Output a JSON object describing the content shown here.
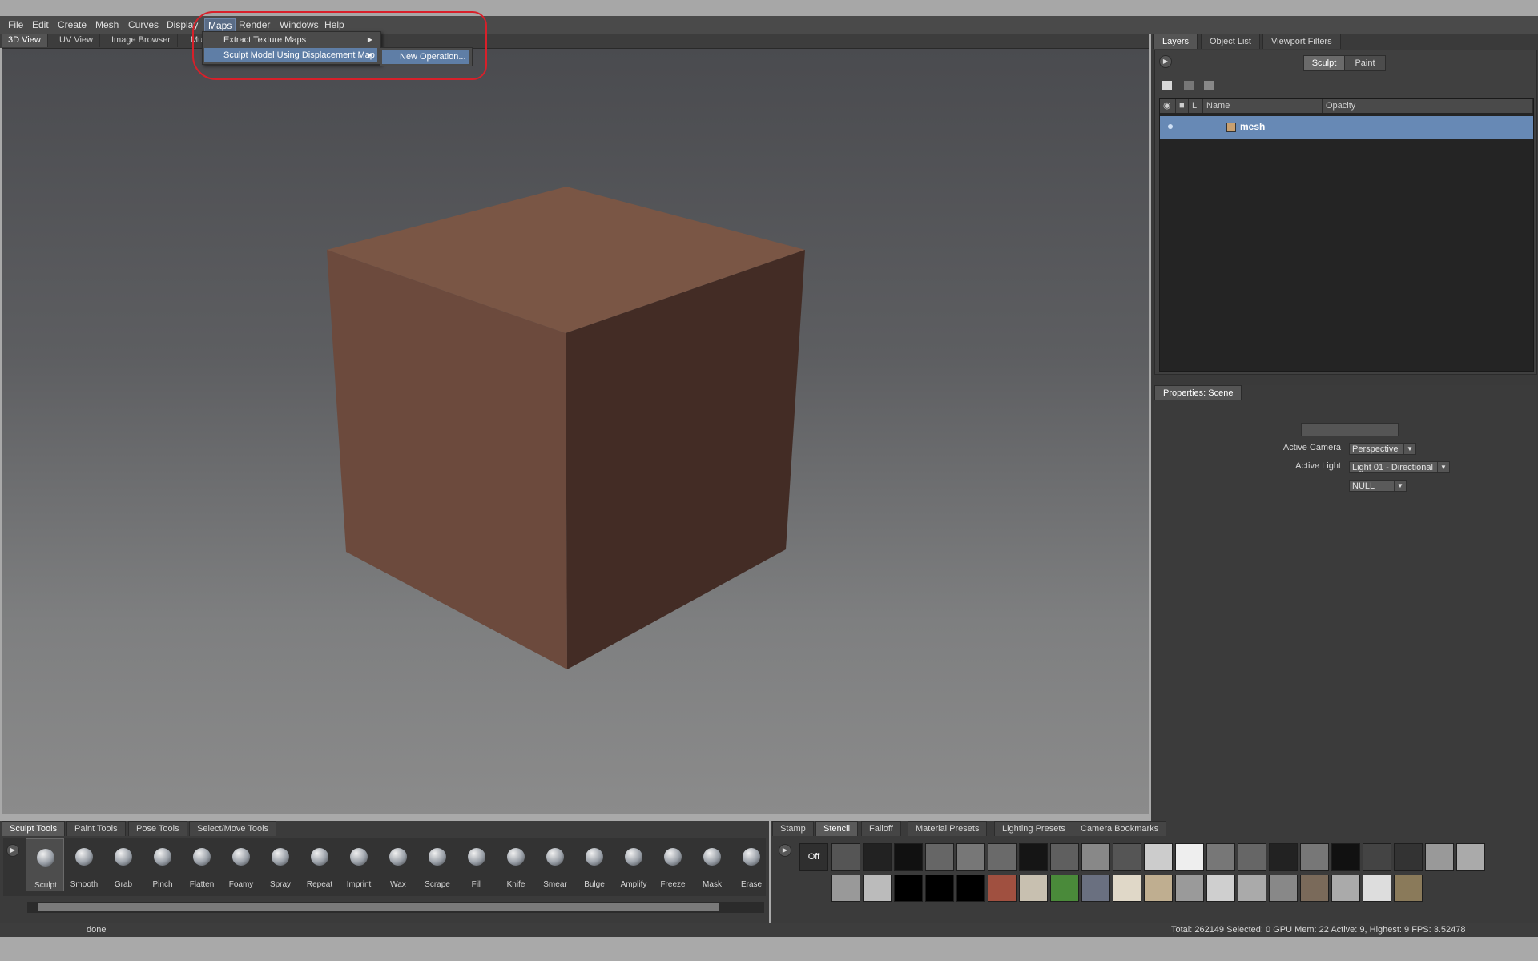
{
  "menubar": {
    "items": [
      "File",
      "Edit",
      "Create",
      "Mesh",
      "Curves",
      "Display",
      "Maps",
      "Render",
      "Windows",
      "Help"
    ],
    "active": "Maps"
  },
  "view_tabs": [
    "3D View",
    "UV View",
    "Image Browser",
    "Mu"
  ],
  "maps_menu": {
    "items": [
      {
        "label": "Extract Texture Maps",
        "submenu": true
      },
      {
        "label": "Sculpt Model Using Displacement Map",
        "submenu": true
      }
    ],
    "submenu_item": "New Operation..."
  },
  "colors": {
    "highlight": "#5f7ea6",
    "annotation_circle": "#d8202a",
    "mesh_face_top": "#7a5645",
    "mesh_face_left": "#6c4a3d",
    "mesh_face_right": "#432c25"
  },
  "right_panel": {
    "tabs": [
      "Layers",
      "Object List",
      "Viewport Filters"
    ],
    "mode_toggle": [
      "Sculpt",
      "Paint"
    ],
    "layer_columns": [
      "L",
      "Name",
      "Opacity"
    ],
    "layers": [
      {
        "name": "mesh"
      }
    ]
  },
  "properties": {
    "tab": "Properties: Scene",
    "active_camera_label": "Active Camera",
    "active_camera_value": "Perspective",
    "active_light_label": "Active Light",
    "active_light_value": "Light 01 - Directional",
    "null_value": "NULL"
  },
  "tool_tray": {
    "tabs": [
      "Sculpt Tools",
      "Paint Tools",
      "Pose Tools",
      "Select/Move Tools"
    ],
    "tools": [
      "Sculpt",
      "Smooth",
      "Grab",
      "Pinch",
      "Flatten",
      "Foamy",
      "Spray",
      "Repeat",
      "Imprint",
      "Wax",
      "Scrape",
      "Fill",
      "Knife",
      "Smear",
      "Bulge",
      "Amplify",
      "Freeze",
      "Mask",
      "Erase"
    ]
  },
  "stamp_tray": {
    "tabs": [
      "Stamp",
      "Stencil",
      "Falloff",
      "Material Presets",
      "Lighting Presets",
      "Camera Bookmarks"
    ],
    "selected_tab": "Stencil",
    "off_label": "Off"
  },
  "status": {
    "message": "done",
    "stats": "Total: 262149  Selected: 0 GPU Mem: 22  Active: 9, Highest: 9  FPS: 3.52478"
  }
}
